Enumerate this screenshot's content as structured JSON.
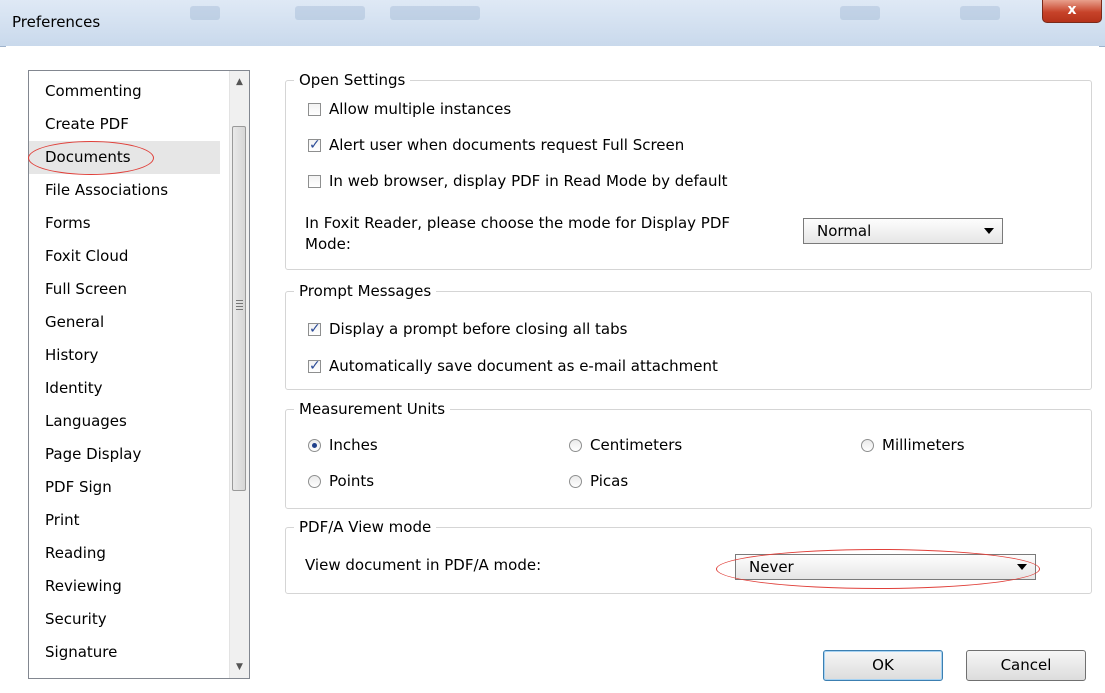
{
  "window": {
    "title": "Preferences",
    "close_label": "x"
  },
  "categories": [
    "Commenting",
    "Create PDF",
    "Documents",
    "File Associations",
    "Forms",
    "Foxit Cloud",
    "Full Screen",
    "General",
    "History",
    "Identity",
    "Languages",
    "Page Display",
    "PDF Sign",
    "Print",
    "Reading",
    "Reviewing",
    "Security",
    "Signature"
  ],
  "selected_category": "Documents",
  "open_settings": {
    "legend": "Open Settings",
    "allow_multiple": {
      "label": "Allow multiple instances",
      "checked": false
    },
    "alert_fullscreen": {
      "label": "Alert user when documents request Full Screen",
      "checked": true
    },
    "web_read_mode": {
      "label": "In web browser, display PDF in Read Mode by default",
      "checked": false
    },
    "display_mode_label_1": "In Foxit Reader, please choose the mode for Display PDF",
    "display_mode_label_2": "Mode:",
    "display_mode_value": "Normal"
  },
  "prompt_messages": {
    "legend": "Prompt Messages",
    "prompt_closing": {
      "label": "Display a prompt before closing all tabs",
      "checked": true
    },
    "autosave_email": {
      "label": "Automatically save document as e-mail attachment",
      "checked": true
    }
  },
  "measurement_units": {
    "legend": "Measurement Units",
    "options": [
      "Inches",
      "Centimeters",
      "Millimeters",
      "Points",
      "Picas"
    ],
    "selected": "Inches"
  },
  "pdfa": {
    "legend": "PDF/A View mode",
    "label": "View document in PDF/A mode:",
    "value": "Never"
  },
  "buttons": {
    "ok": "OK",
    "cancel": "Cancel"
  },
  "colors": {
    "annotation_ellipse": "#e0403a",
    "check_mark": "#2a4a96",
    "close_button": "#c7432a"
  }
}
